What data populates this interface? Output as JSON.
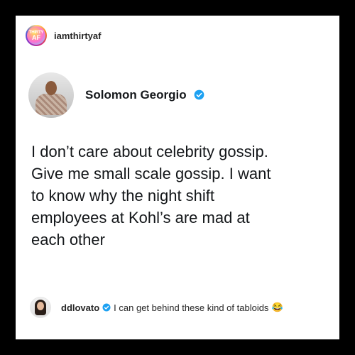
{
  "post": {
    "account_avatar": {
      "line1": "THIRTY",
      "line2": "AF"
    },
    "account_username": "iamthirtyaf"
  },
  "tweet": {
    "author_name": "Solomon Georgio",
    "verified": true,
    "text": "I don’t care about celebrity gossip.\nGive me small scale gossip. I want\nto know why the night shift\nemployees at Kohl’s are mad at\neach other"
  },
  "comment": {
    "username": "ddlovato",
    "verified": true,
    "text": "I can get behind these kind of tabloids",
    "emoji": "😂"
  },
  "colors": {
    "verified_blue": "#1DA1F2",
    "text": "#14171a",
    "background": "#ffffff",
    "frame": "#000000"
  }
}
